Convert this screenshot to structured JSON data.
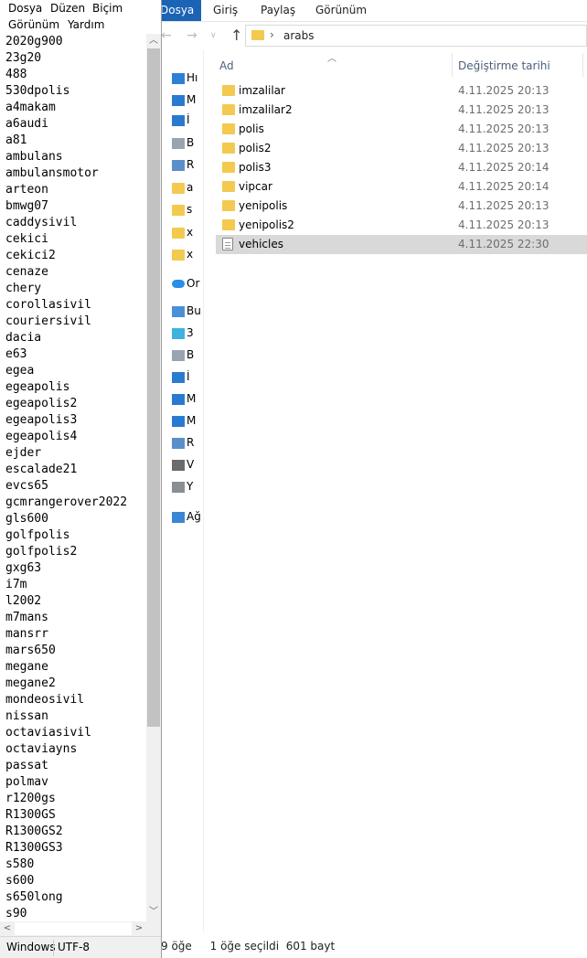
{
  "explorer": {
    "ribbon": {
      "tabs": [
        "Dosya",
        "Giriş",
        "Paylaş",
        "Görünüm"
      ]
    },
    "address": {
      "path": "arabs",
      "separator": "›"
    },
    "nav_pane": {
      "items": [
        {
          "label": "Hı",
          "icon": "quick-access-star-icon"
        },
        {
          "label": "M",
          "icon": "desktop-icon"
        },
        {
          "label": "İ",
          "icon": "download-arrow-icon"
        },
        {
          "label": "B",
          "icon": "document-icon"
        },
        {
          "label": "R",
          "icon": "picture-icon"
        },
        {
          "label": "a",
          "icon": "folder-icon"
        },
        {
          "label": "s",
          "icon": "folder-icon"
        },
        {
          "label": "x",
          "icon": "folder-icon"
        },
        {
          "label": "x",
          "icon": "folder-icon"
        },
        {
          "label": "Or",
          "icon": "onedrive-cloud-icon"
        },
        {
          "label": "Bu",
          "icon": "this-pc-icon"
        },
        {
          "label": "3",
          "icon": "3d-objects-icon"
        },
        {
          "label": "B",
          "icon": "document-icon"
        },
        {
          "label": "İ",
          "icon": "download-arrow-icon"
        },
        {
          "label": "M",
          "icon": "desktop-icon"
        },
        {
          "label": "M",
          "icon": "music-note-icon"
        },
        {
          "label": "R",
          "icon": "picture-icon"
        },
        {
          "label": "V",
          "icon": "video-icon"
        },
        {
          "label": "Y",
          "icon": "drive-icon"
        },
        {
          "label": "Ağ",
          "icon": "network-icon"
        }
      ]
    },
    "columns": {
      "name": "Ad",
      "date": "Değiştirme tarihi"
    },
    "files": [
      {
        "name": "imzalilar",
        "date": "4.11.2025 20:13",
        "type": "folder"
      },
      {
        "name": "imzalilar2",
        "date": "4.11.2025 20:13",
        "type": "folder"
      },
      {
        "name": "polis",
        "date": "4.11.2025 20:13",
        "type": "folder"
      },
      {
        "name": "polis2",
        "date": "4.11.2025 20:13",
        "type": "folder"
      },
      {
        "name": "polis3",
        "date": "4.11.2025 20:14",
        "type": "folder"
      },
      {
        "name": "vipcar",
        "date": "4.11.2025 20:14",
        "type": "folder"
      },
      {
        "name": "yenipolis",
        "date": "4.11.2025 20:13",
        "type": "folder"
      },
      {
        "name": "yenipolis2",
        "date": "4.11.2025 20:13",
        "type": "folder"
      },
      {
        "name": "vehicles",
        "date": "4.11.2025 22:30",
        "type": "text-file",
        "selected": true
      }
    ],
    "status": {
      "count": "9 öğe",
      "selection": "1 öğe seçildi  601 bayt"
    }
  },
  "notepad": {
    "menu": [
      "Dosya",
      "Düzen",
      "Biçim",
      "Görünüm",
      "Yardım"
    ],
    "lines": [
      "2020g900",
      "23g20",
      "488",
      "530dpolis",
      "a4makam",
      "a6audi",
      "a81",
      "ambulans",
      "ambulansmotor",
      "arteon",
      "bmwg07",
      "caddysivil",
      "cekici",
      "cekici2",
      "cenaze",
      "chery",
      "corollasivil",
      "couriersivil",
      "dacia",
      "e63",
      "egea",
      "egeapolis",
      "egeapolis2",
      "egeapolis3",
      "egeapolis4",
      "ejder",
      "escalade21",
      "evcs65",
      "gcmrangerover2022",
      "gls600",
      "golfpolis",
      "golfpolis2",
      "gxg63",
      "i7m",
      "l2002",
      "m7mans",
      "mansrr",
      "mars650",
      "megane",
      "megane2",
      "mondeosivil",
      "nissan",
      "octaviasivil",
      "octaviayns",
      "passat",
      "polmav",
      "r1200gs",
      "R1300GS",
      "R1300GS2",
      "R1300GS3",
      "s580",
      "s600",
      "s650long",
      "s90"
    ],
    "status": {
      "line_ending": "Windows",
      "encoding": "UTF-8"
    }
  },
  "colors": {
    "ribbon_file_tab": "#1a63b5",
    "folder": "#f3c94f",
    "selection": "#d9d9d9"
  }
}
